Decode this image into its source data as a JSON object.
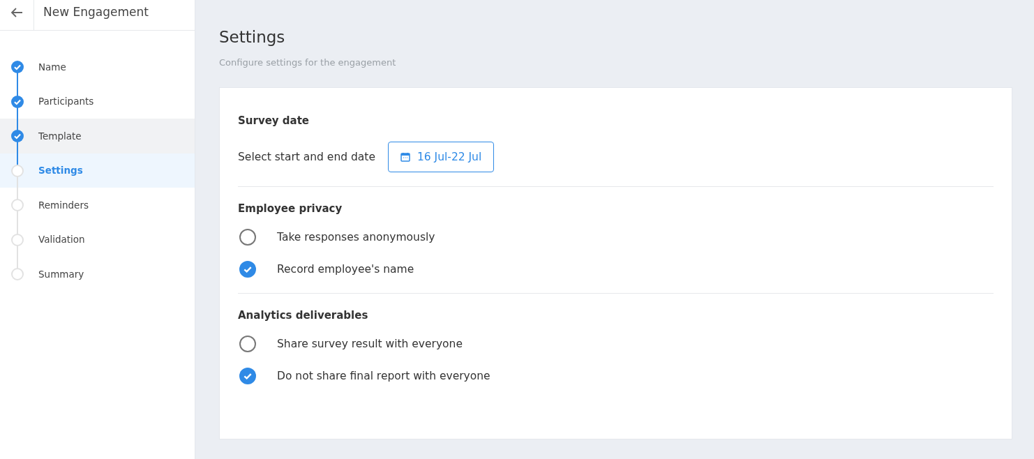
{
  "header": {
    "title": "New Engagement"
  },
  "steps": [
    {
      "label": "Name",
      "done": true,
      "selected": false,
      "hovered": false
    },
    {
      "label": "Participants",
      "done": true,
      "selected": false,
      "hovered": false
    },
    {
      "label": "Template",
      "done": true,
      "selected": false,
      "hovered": true
    },
    {
      "label": "Settings",
      "done": false,
      "selected": true,
      "hovered": false
    },
    {
      "label": "Reminders",
      "done": false,
      "selected": false,
      "hovered": false
    },
    {
      "label": "Validation",
      "done": false,
      "selected": false,
      "hovered": false
    },
    {
      "label": "Summary",
      "done": false,
      "selected": false,
      "hovered": false
    }
  ],
  "page": {
    "title": "Settings",
    "subtitle": "Configure settings for the engagement"
  },
  "sections": [
    {
      "kind": "date",
      "title": "Survey date",
      "label": "Select start and end date",
      "value": "16 Jul-22 Jul"
    },
    {
      "kind": "options",
      "title": "Employee privacy",
      "options": [
        {
          "label": "Take responses anonymously",
          "selected": false
        },
        {
          "label": "Record employee's name",
          "selected": true
        }
      ]
    },
    {
      "kind": "options",
      "title": "Analytics deliverables",
      "options": [
        {
          "label": "Share survey result with everyone",
          "selected": false
        },
        {
          "label": "Do not share final report with everyone",
          "selected": true
        }
      ]
    }
  ]
}
